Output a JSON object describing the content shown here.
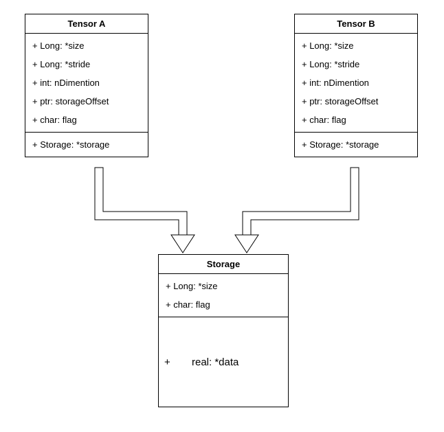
{
  "classes": {
    "tensorA": {
      "title": "Tensor A",
      "attrs": [
        "+ Long: *size",
        "+ Long: *stride",
        "+ int:  nDimention",
        "+ ptr: storageOffset",
        "+ char: flag"
      ],
      "refs": [
        "+ Storage: *storage"
      ]
    },
    "tensorB": {
      "title": "Tensor B",
      "attrs": [
        "+ Long: *size",
        "+ Long: *stride",
        "+ int:  nDimention",
        "+ ptr: storageOffset",
        "+ char: flag"
      ],
      "refs": [
        "+ Storage: *storage"
      ]
    },
    "storage": {
      "title": "Storage",
      "attrs": [
        "+ Long: *size",
        "+ char: flag"
      ],
      "data_plus": "+",
      "data_label": "real: *data"
    }
  },
  "chart_data": {
    "type": "table",
    "description": "UML-style class diagram: two Tensor structs (Tensor A, Tensor B) each point to a shared Storage struct.",
    "nodes": [
      {
        "id": "TensorA",
        "title": "Tensor A",
        "compartments": [
          [
            "+ Long: *size",
            "+ Long: *stride",
            "+ int: nDimention",
            "+ ptr: storageOffset",
            "+ char: flag"
          ],
          [
            "+ Storage: *storage"
          ]
        ]
      },
      {
        "id": "TensorB",
        "title": "Tensor B",
        "compartments": [
          [
            "+ Long: *size",
            "+ Long: *stride",
            "+ int: nDimention",
            "+ ptr: storageOffset",
            "+ char: flag"
          ],
          [
            "+ Storage: *storage"
          ]
        ]
      },
      {
        "id": "Storage",
        "title": "Storage",
        "compartments": [
          [
            "+ Long: *size",
            "+ char: flag"
          ],
          [
            "+ real: *data"
          ]
        ]
      }
    ],
    "edges": [
      {
        "from": "TensorA",
        "to": "Storage",
        "style": "open-arrow"
      },
      {
        "from": "TensorB",
        "to": "Storage",
        "style": "open-arrow"
      }
    ]
  }
}
